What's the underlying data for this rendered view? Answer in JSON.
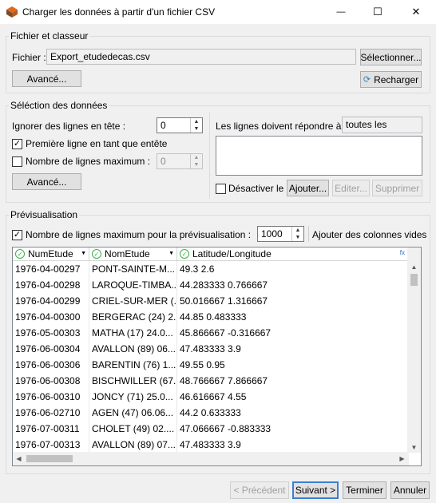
{
  "window": {
    "title": "Charger les données à partir d'un fichier CSV",
    "minimize_glyph": "—",
    "maximize_glyph": "☐",
    "close_glyph": "✕"
  },
  "file_group": {
    "label": "Fichier et classeur",
    "file_label": "Fichier :",
    "file_value": "Export_etudedecas.csv",
    "select_button": "Sélectionner...",
    "advanced_button": "Avancé...",
    "reload_button": "Recharger"
  },
  "selection_group": {
    "label": "Séléction des données",
    "ignore_label": "Ignorer des lignes en tête :",
    "ignore_value": "0",
    "first_line_header_label": "Première ligne en tant que entête",
    "first_line_header_checked": true,
    "max_lines_label": "Nombre de lignes maximum :",
    "max_lines_checked": false,
    "max_lines_value": "0",
    "advanced_button": "Avancé...",
    "conditions_label": "Les lignes doivent répondre à",
    "conditions_value": "toutes les",
    "disable_label": "Désactiver les",
    "add_button": "Ajouter...",
    "edit_button": "Editer...",
    "delete_button": "Supprimer"
  },
  "preview_group": {
    "label": "Prévisualisation",
    "max_preview_label": "Nombre de lignes maximum pour la prévisualisation :",
    "max_preview_checked": true,
    "max_preview_value": "1000",
    "add_columns_label": "Ajouter des colonnes vides",
    "columns": [
      "NumEtude",
      "NomEtude",
      "Latitude/Longitude"
    ],
    "rows": [
      [
        "1976-04-00297",
        "PONT-SAINTE-M...",
        "49.3 2.6"
      ],
      [
        "1976-04-00298",
        "LAROQUE-TIMBA...",
        "44.283333 0.766667"
      ],
      [
        "1976-04-00299",
        "CRIEL-SUR-MER (...",
        "50.016667 1.316667"
      ],
      [
        "1976-04-00300",
        "BERGERAC (24) 2...",
        "44.85 0.483333"
      ],
      [
        "1976-05-00303",
        "MATHA (17) 24.0...",
        "45.866667 -0.316667"
      ],
      [
        "1976-06-00304",
        "AVALLON (89) 06...",
        "47.483333 3.9"
      ],
      [
        "1976-06-00306",
        "BARENTIN (76) 1...",
        "49.55 0.95"
      ],
      [
        "1976-06-00308",
        "BISCHWILLER (67...",
        "48.766667 7.866667"
      ],
      [
        "1976-06-00310",
        "JONCY (71) 25.0...",
        "46.616667 4.55"
      ],
      [
        "1976-06-02710",
        "AGEN (47) 06.06...",
        "44.2 0.633333"
      ],
      [
        "1976-07-00311",
        "CHOLET (49) 02....",
        "47.066667 -0.883333"
      ],
      [
        "1976-07-00313",
        "AVALLON (89) 07...",
        "47.483333 3.9"
      ]
    ]
  },
  "footer": {
    "previous_button": "< Précédent",
    "next_button": "Suivant >",
    "finish_button": "Terminer",
    "cancel_button": "Annuler"
  }
}
